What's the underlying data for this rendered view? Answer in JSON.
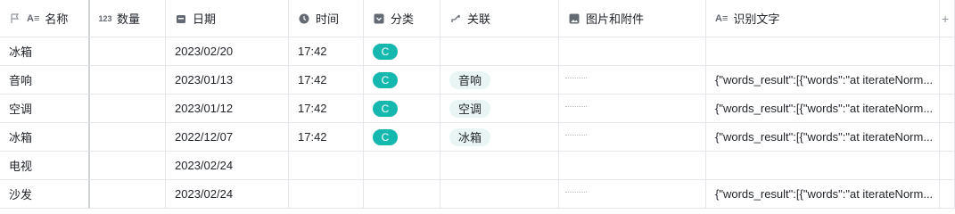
{
  "columns": [
    {
      "label": "名称",
      "icon": "text-icon"
    },
    {
      "label": "数量",
      "icon": "number-icon"
    },
    {
      "label": "日期",
      "icon": "calendar-icon"
    },
    {
      "label": "时间",
      "icon": "clock-icon"
    },
    {
      "label": "分类",
      "icon": "single-select-icon"
    },
    {
      "label": "关联",
      "icon": "link-icon"
    },
    {
      "label": "图片和附件",
      "icon": "image-icon"
    },
    {
      "label": "识别文字",
      "icon": "text-icon"
    }
  ],
  "rows": [
    {
      "name": "冰箱",
      "qty": "",
      "date": "2023/02/20",
      "time": "17:42",
      "category": "C",
      "link": "",
      "ocr": ""
    },
    {
      "name": "音响",
      "qty": "",
      "date": "2023/01/13",
      "time": "17:42",
      "category": "C",
      "link": "音响",
      "ocr": "{\"words_result\":[{\"words\":\"at iterateNorm..."
    },
    {
      "name": "空调",
      "qty": "",
      "date": "2023/01/12",
      "time": "17:42",
      "category": "C",
      "link": "空调",
      "ocr": "{\"words_result\":[{\"words\":\"at iterateNorm..."
    },
    {
      "name": "冰箱",
      "qty": "",
      "date": "2022/12/07",
      "time": "17:42",
      "category": "C",
      "link": "冰箱",
      "ocr": "{\"words_result\":[{\"words\":\"at iterateNorm..."
    },
    {
      "name": "电视",
      "qty": "",
      "date": "2023/02/24",
      "time": "",
      "category": "",
      "link": "",
      "ocr": ""
    },
    {
      "name": "沙发",
      "qty": "",
      "date": "2023/02/24",
      "time": "",
      "category": "",
      "link": "",
      "ocr": "{\"words_result\":[{\"words\":\"at iterateNorm..."
    }
  ],
  "colors": {
    "tag_bg": "#14b8ae",
    "link_bg": "#e8f5f4",
    "border": "#e5e6eb"
  }
}
